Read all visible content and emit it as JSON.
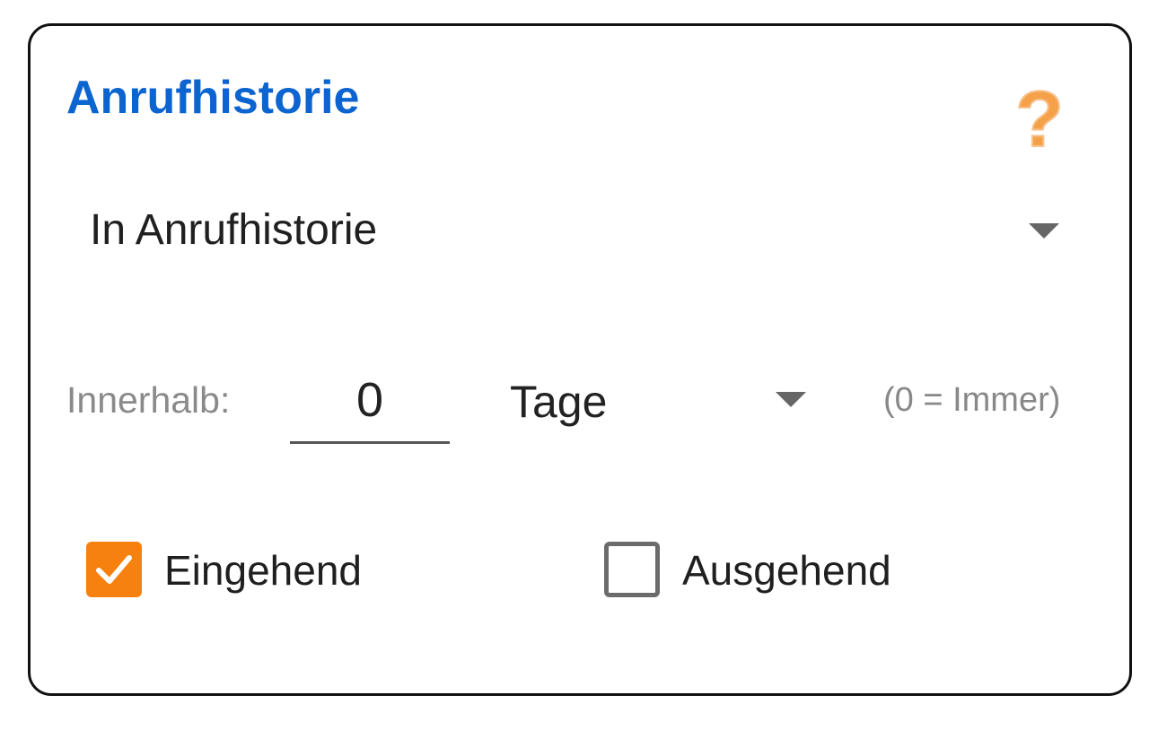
{
  "card": {
    "title": "Anrufhistorie",
    "help_icon": "question-mark-icon",
    "colors": {
      "title": "#0b64d0",
      "help_icon": "#f5a14a",
      "checkbox_checked": "#f7810f"
    }
  },
  "history_select": {
    "value": "In Anrufhistorie",
    "icon": "dropdown-caret-icon"
  },
  "within": {
    "label": "Innerhalb:",
    "days_value": "0",
    "unit_value": "Tage",
    "hint": "(0 = Immer)"
  },
  "checkboxes": [
    {
      "label": "Eingehend",
      "checked": true
    },
    {
      "label": "Ausgehend",
      "checked": false
    }
  ]
}
